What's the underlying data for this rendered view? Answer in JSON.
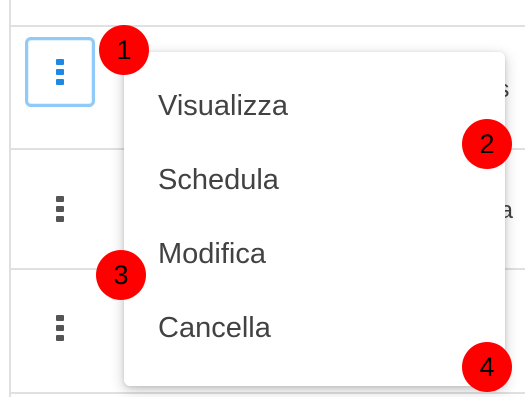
{
  "table": {
    "rows": [
      {
        "cell_text": "is"
      },
      {
        "cell_text": "ta"
      },
      {
        "cell_text": ""
      }
    ]
  },
  "row_actions": {
    "icon": "more-vertical-icon",
    "active_color": "#1e88e5",
    "focus_ring_color": "#90caf9"
  },
  "menu": {
    "items": [
      {
        "label": "Visualizza"
      },
      {
        "label": "Schedula"
      },
      {
        "label": "Modifica"
      },
      {
        "label": "Cancella"
      }
    ]
  },
  "annotations": {
    "color": "#ff0000",
    "badges": [
      "1",
      "2",
      "3",
      "4"
    ]
  }
}
